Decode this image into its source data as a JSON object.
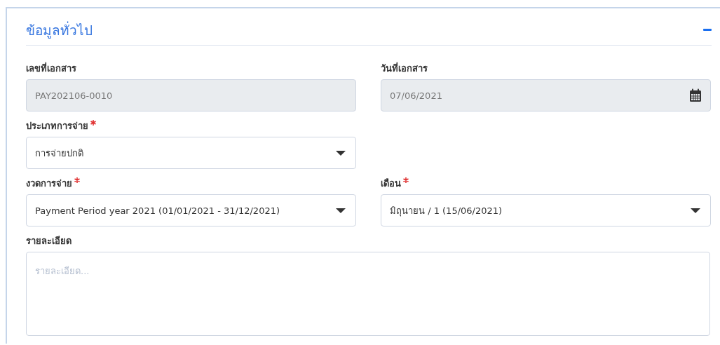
{
  "section": {
    "title": "ข้อมูลทั่วไป",
    "expanded": true
  },
  "rows": [
    [
      {
        "kind": "text",
        "label": "เลขที่เอกสาร",
        "required": false,
        "disabled": true,
        "value": "PAY202106-0010"
      },
      {
        "kind": "date",
        "label": "วันที่เอกสาร",
        "required": false,
        "disabled": true,
        "value": "07/06/2021"
      }
    ],
    [
      {
        "kind": "select",
        "label": "ประเภทการจ่าย",
        "required": true,
        "disabled": false,
        "value": "การจ่ายปกติ"
      }
    ],
    [
      {
        "kind": "select",
        "label": "งวดการจ่าย",
        "required": true,
        "disabled": false,
        "value": "Payment Period year 2021 (01/01/2021 - 31/12/2021)"
      },
      {
        "kind": "select",
        "label": "เดือน",
        "required": true,
        "disabled": false,
        "value": "มิถุนายน / 1 (15/06/2021)"
      }
    ],
    [
      {
        "kind": "textarea",
        "label": "รายละเอียด",
        "required": false,
        "disabled": false,
        "placeholder": "รายละเอียด..."
      }
    ]
  ]
}
